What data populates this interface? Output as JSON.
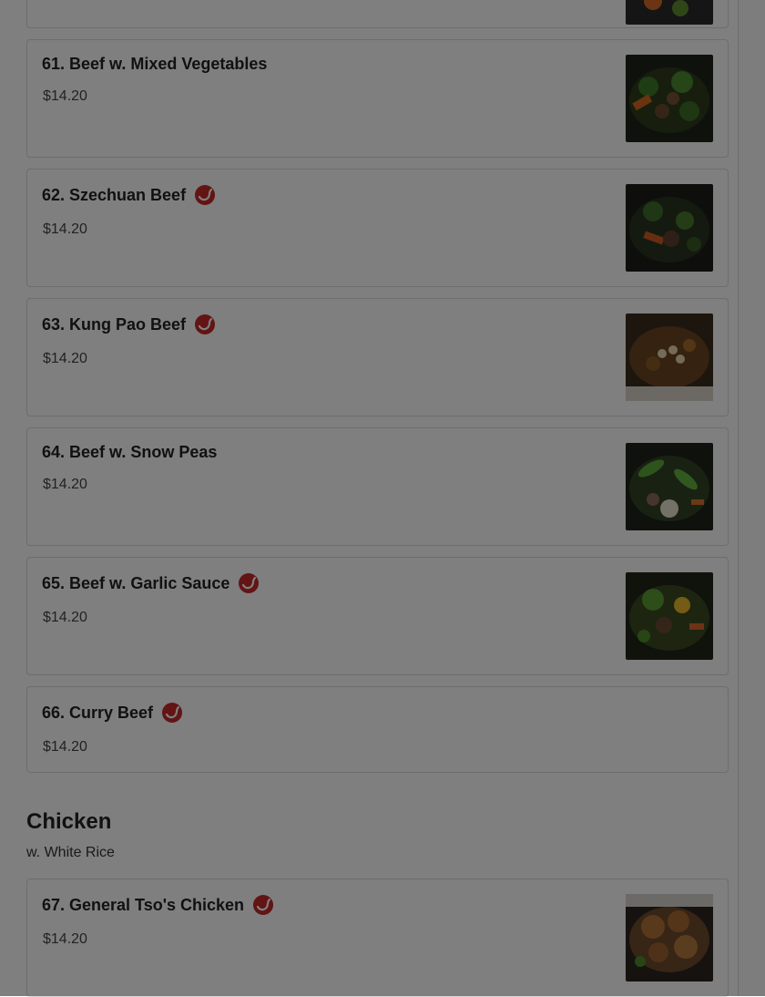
{
  "items": [
    {
      "name": "61. Beef w. Mixed Vegetables",
      "price": "$14.20",
      "spicy": false,
      "image": "beef-mixed-vegetables-photo"
    },
    {
      "name": "62. Szechuan Beef",
      "price": "$14.20",
      "spicy": true,
      "image": "szechuan-beef-photo"
    },
    {
      "name": "63. Kung Pao Beef",
      "price": "$14.20",
      "spicy": true,
      "image": "kung-pao-beef-photo"
    },
    {
      "name": "64. Beef w. Snow Peas",
      "price": "$14.20",
      "spicy": false,
      "image": "beef-snow-peas-photo"
    },
    {
      "name": "65. Beef w. Garlic Sauce",
      "price": "$14.20",
      "spicy": true,
      "image": "beef-garlic-sauce-photo"
    },
    {
      "name": "66. Curry Beef",
      "price": "$14.20",
      "spicy": true,
      "image": ""
    },
    {
      "name": "67. General Tso's Chicken",
      "price": "$14.20",
      "spicy": true,
      "image": "general-tsos-chicken-photo"
    }
  ],
  "section": {
    "title": "Chicken",
    "subtitle": "w. White Rice"
  },
  "colors": {
    "spicy": "#c62828",
    "overlay": "rgba(0,0,0,0.5)"
  }
}
